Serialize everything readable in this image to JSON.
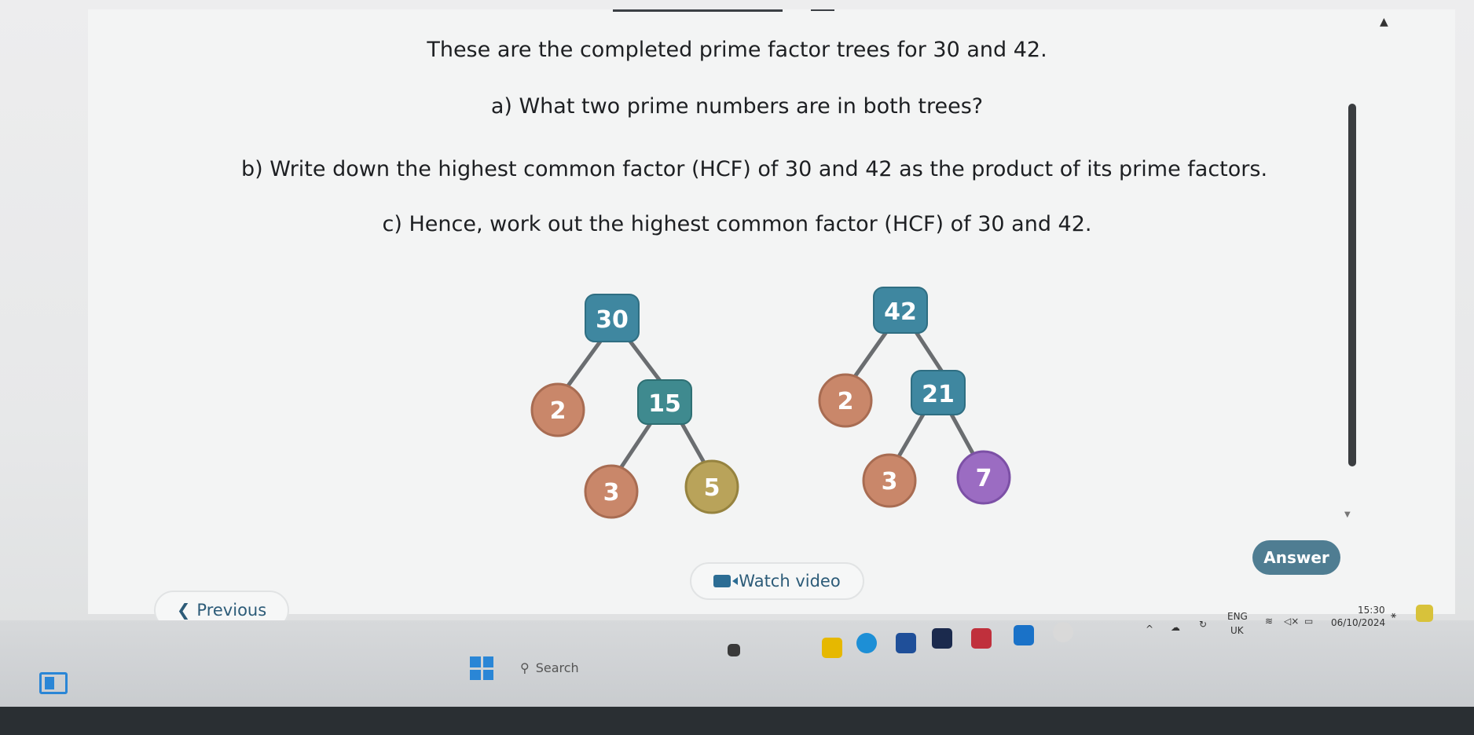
{
  "question": {
    "intro": "These are the completed prime factor trees for 30 and 42.",
    "part_a": "a) What two prime numbers are in both trees?",
    "part_b": "b) Write down the highest common factor (HCF) of 30 and 42 as the product of its prime factors.",
    "part_c": "c) Hence, work out the highest common factor (HCF) of 30 and 42."
  },
  "trees": {
    "tree_30": {
      "root": "30",
      "prime_left": "2",
      "composite": "15",
      "leaf_left": "3",
      "leaf_right": "5"
    },
    "tree_42": {
      "root": "42",
      "prime_left": "2",
      "composite": "21",
      "leaf_left": "3",
      "leaf_right": "7"
    }
  },
  "buttons": {
    "answer": "Answer",
    "watch_video": "Watch video",
    "previous": "Previous"
  },
  "taskbar": {
    "search_placeholder": "Search",
    "language": "ENG",
    "region": "UK",
    "time": "15:30",
    "date": "06/10/2024"
  },
  "colors": {
    "composite_node": "#3f87a0",
    "prime_2_3_node": "#c9876a",
    "prime_5_node": "#b9a35a",
    "prime_7_node": "#9b6cc2",
    "answer_button": "#4f7d92"
  },
  "icons": [
    "search-icon",
    "windows-start-icon",
    "wifi-icon",
    "volume-icon",
    "battery-icon",
    "bell-icon",
    "video-icon",
    "chevron-left-icon"
  ]
}
